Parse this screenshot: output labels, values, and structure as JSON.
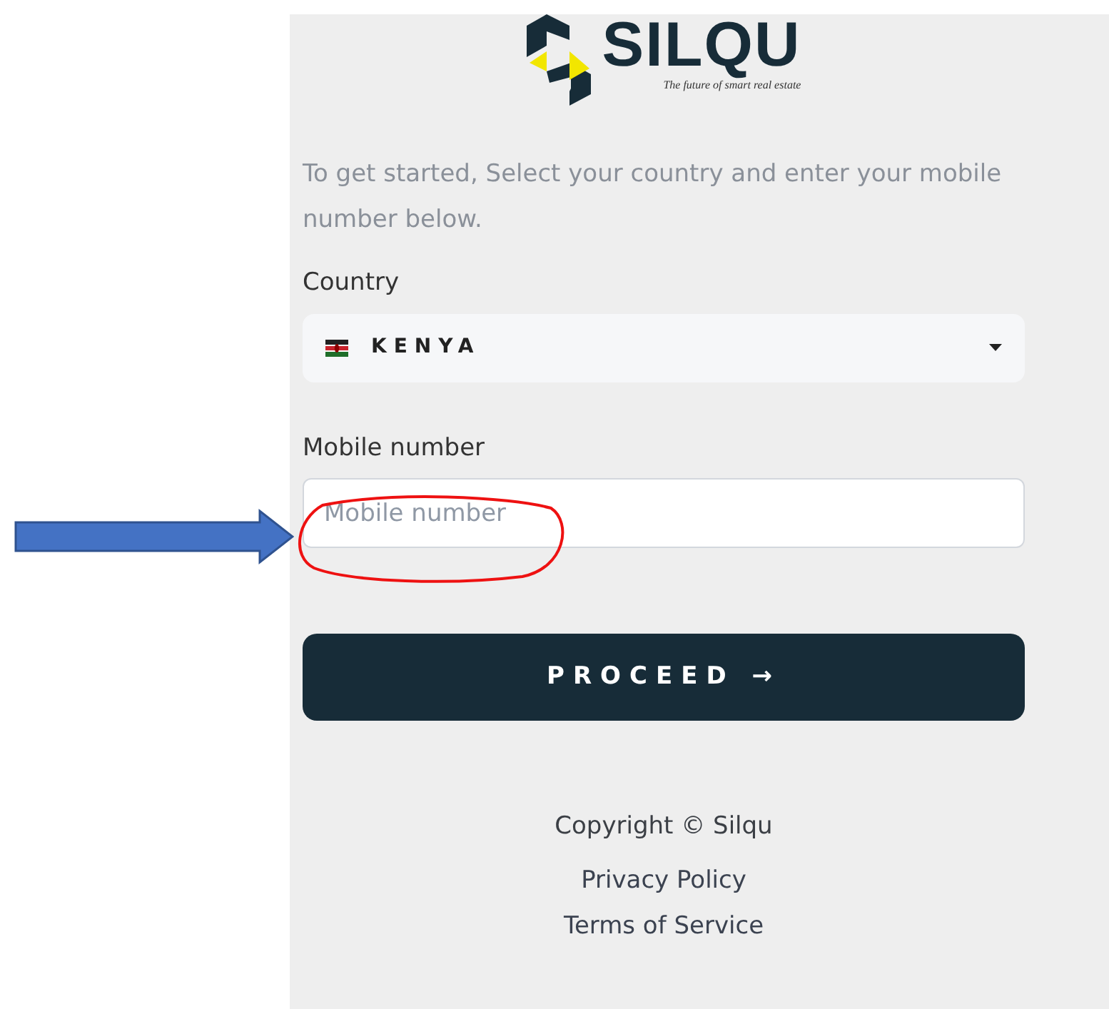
{
  "logo": {
    "name": "SILQU",
    "tagline": "The future of smart real estate"
  },
  "intro": "To get started, Select your country and enter your mobile number below.",
  "country": {
    "label": "Country",
    "value": "KENYA"
  },
  "mobile": {
    "label": "Mobile number",
    "placeholder": "Mobile number"
  },
  "submit": {
    "label": "PROCEED →"
  },
  "footer": {
    "copyright": "Copyright © Silqu",
    "links": [
      "Privacy Policy",
      "Terms of Service"
    ]
  }
}
